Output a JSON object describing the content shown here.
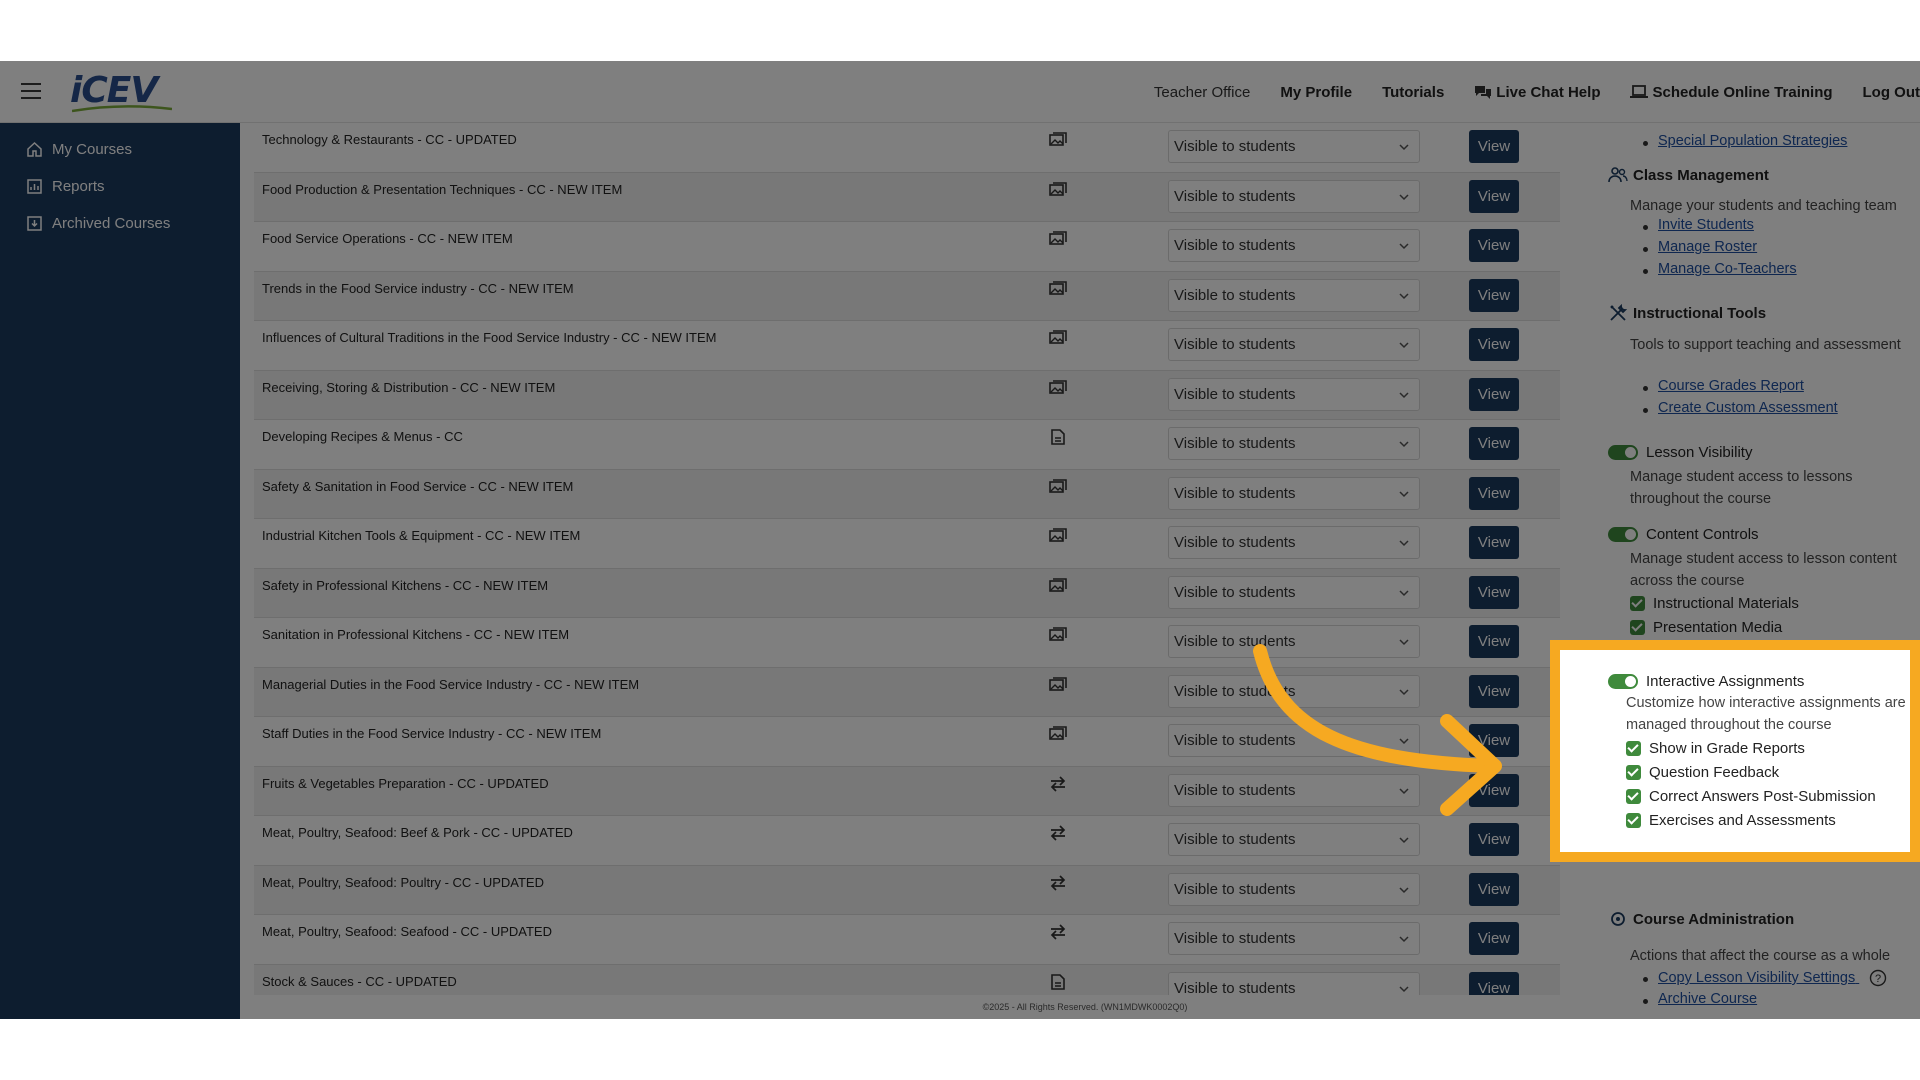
{
  "header": {
    "logo_text": "iCEV",
    "nav": [
      {
        "label": "Teacher Office",
        "icon": ""
      },
      {
        "label": "My Profile",
        "icon": ""
      },
      {
        "label": "Tutorials",
        "icon": ""
      },
      {
        "label": "Live Chat Help",
        "icon": "chat-icon"
      },
      {
        "label": "Schedule Online Training",
        "icon": "laptop-icon"
      },
      {
        "label": "Log Out",
        "icon": ""
      }
    ]
  },
  "sidebar": {
    "items": [
      {
        "label": "My Courses",
        "icon": "home-icon"
      },
      {
        "label": "Reports",
        "icon": "chart-icon"
      },
      {
        "label": "Archived Courses",
        "icon": "archive-icon"
      }
    ]
  },
  "lessons": {
    "select_value": "Visible to students",
    "view_label": "View",
    "rows": [
      {
        "title": "Technology & Restaurants - CC - UPDATED",
        "type": "gallery-icon"
      },
      {
        "title": "Food Production & Presentation Techniques - CC - NEW ITEM",
        "type": "gallery-icon"
      },
      {
        "title": "Food Service Operations - CC - NEW ITEM",
        "type": "gallery-icon"
      },
      {
        "title": "Trends in the Food Service industry - CC - NEW ITEM",
        "type": "gallery-icon"
      },
      {
        "title": "Influences of Cultural Traditions in the Food Service Industry - CC - NEW ITEM",
        "type": "gallery-icon"
      },
      {
        "title": "Receiving, Storing & Distribution - CC - NEW ITEM",
        "type": "gallery-icon"
      },
      {
        "title": "Developing Recipes & Menus - CC",
        "type": "document-icon"
      },
      {
        "title": "Safety & Sanitation in Food Service - CC - NEW ITEM",
        "type": "gallery-icon"
      },
      {
        "title": "Industrial Kitchen Tools & Equipment - CC - NEW ITEM",
        "type": "gallery-icon"
      },
      {
        "title": "Safety in Professional Kitchens - CC - NEW ITEM",
        "type": "gallery-icon"
      },
      {
        "title": "Sanitation in Professional Kitchens - CC - NEW ITEM",
        "type": "gallery-icon"
      },
      {
        "title": "Managerial Duties in the Food Service Industry - CC - NEW ITEM",
        "type": "gallery-icon"
      },
      {
        "title": "Staff Duties in the Food Service Industry - CC - NEW ITEM",
        "type": "gallery-icon"
      },
      {
        "title": "Fruits & Vegetables Preparation - CC - UPDATED",
        "type": "swap-icon"
      },
      {
        "title": "Meat, Poultry, Seafood: Beef & Pork - CC - UPDATED",
        "type": "swap-icon"
      },
      {
        "title": "Meat, Poultry, Seafood: Poultry - CC - UPDATED",
        "type": "swap-icon"
      },
      {
        "title": "Meat, Poultry, Seafood: Seafood - CC - UPDATED",
        "type": "swap-icon"
      },
      {
        "title": "Stock & Sauces - CC - UPDATED",
        "type": "document-icon"
      }
    ]
  },
  "footer": {
    "text": "©2025 - All Rights Reserved. (WN1MDWK0002Q0)"
  },
  "panel": {
    "top_link": "Special Population Strategies",
    "class_mgmt": {
      "title": "Class Management",
      "desc": "Manage your students and teaching team",
      "links": [
        "Invite Students",
        "Manage Roster",
        "Manage Co-Teachers"
      ]
    },
    "instr_tools": {
      "title": "Instructional Tools",
      "desc": "Tools to support teaching and assessment",
      "links": [
        "Course Grades Report",
        "Create Custom Assessment"
      ]
    },
    "lesson_visibility": {
      "title": "Lesson Visibility",
      "desc": "Manage student access to lessons throughout the course"
    },
    "content_controls": {
      "title": "Content Controls",
      "desc": "Manage student access to lesson content across the course",
      "checks": [
        "Instructional Materials",
        "Presentation Media"
      ]
    },
    "interactive": {
      "title": "Interactive Assignments",
      "desc": "Customize how interactive assignments are managed throughout the course",
      "checks": [
        "Show in Grade Reports",
        "Question Feedback",
        "Correct Answers Post-Submission",
        "Exercises and Assessments"
      ]
    },
    "course_admin": {
      "title": "Course Administration",
      "desc": "Actions that affect the course as a whole",
      "links": [
        "Copy Lesson Visibility Settings",
        "Archive Course"
      ]
    }
  },
  "colors": {
    "sidebar": "#1b3a5f",
    "view_button": "#1b3a5f",
    "toggle_on": "#3f8a3c",
    "highlight": "#f6a921",
    "link": "#1e4fa0"
  }
}
